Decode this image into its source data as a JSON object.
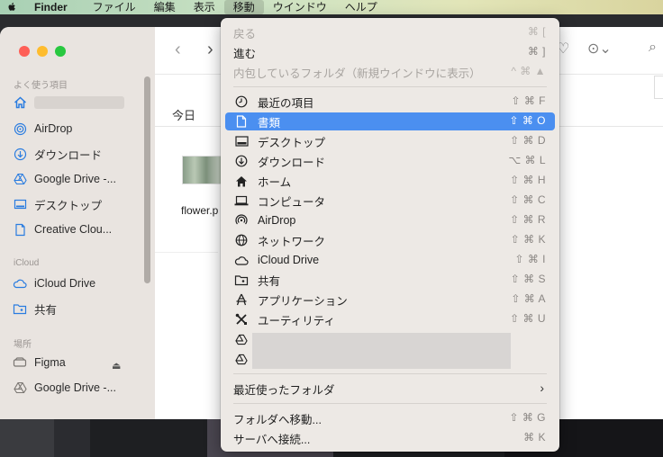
{
  "menubar": {
    "items": [
      {
        "label": "Finder",
        "bold": true,
        "active": false
      },
      {
        "label": "ファイル",
        "bold": false,
        "active": false
      },
      {
        "label": "編集",
        "bold": false,
        "active": false
      },
      {
        "label": "表示",
        "bold": false,
        "active": false
      },
      {
        "label": "移動",
        "bold": false,
        "active": true
      },
      {
        "label": "ウインドウ",
        "bold": false,
        "active": false
      },
      {
        "label": "ヘルプ",
        "bold": false,
        "active": false
      }
    ]
  },
  "sidebar": {
    "sections": {
      "favorites": "よく使う項目",
      "icloud": "iCloud",
      "locations": "場所"
    },
    "items": [
      {
        "label": "",
        "icon": "house-icon"
      },
      {
        "label": "AirDrop",
        "icon": "airdrop-icon"
      },
      {
        "label": "ダウンロード",
        "icon": "download-icon"
      },
      {
        "label": "Google Drive -...",
        "icon": "google-drive-icon"
      },
      {
        "label": "デスクトップ",
        "icon": "desktop-icon"
      },
      {
        "label": "Creative Clou...",
        "icon": "document-icon"
      },
      {
        "label": "iCloud Drive",
        "icon": "cloud-icon"
      },
      {
        "label": "共有",
        "icon": "shared-folder-icon"
      },
      {
        "label": "Figma",
        "icon": "drive-icon"
      },
      {
        "label": "Google Drive -...",
        "icon": "google-drive-icon"
      }
    ]
  },
  "content": {
    "group_header": "今日",
    "file_name": "flower.p"
  },
  "menu": {
    "items": [
      {
        "label": "戻る",
        "shortcut": "⌘ [",
        "disabled": true
      },
      {
        "label": "進む",
        "shortcut": "⌘ ]",
        "disabled": false
      },
      {
        "label": "内包しているフォルダ（新規ウインドウに表示）",
        "shortcut": "^ ⌘ ▲",
        "disabled": true
      },
      {
        "label": "最近の項目",
        "shortcut": "⇧ ⌘ F",
        "icon": "clock-icon"
      },
      {
        "label": "書類",
        "shortcut": "⇧ ⌘ O",
        "icon": "document-icon",
        "highlighted": true
      },
      {
        "label": "デスクトップ",
        "shortcut": "⇧ ⌘ D",
        "icon": "desktop-icon"
      },
      {
        "label": "ダウンロード",
        "shortcut": "⌥ ⌘ L",
        "icon": "download-icon"
      },
      {
        "label": "ホーム",
        "shortcut": "⇧ ⌘ H",
        "icon": "house-icon"
      },
      {
        "label": "コンピュータ",
        "shortcut": "⇧ ⌘ C",
        "icon": "laptop-icon"
      },
      {
        "label": "AirDrop",
        "shortcut": "⇧ ⌘ R",
        "icon": "airdrop-icon"
      },
      {
        "label": "ネットワーク",
        "shortcut": "⇧ ⌘ K",
        "icon": "globe-icon"
      },
      {
        "label": "iCloud Drive",
        "shortcut": "⇧ ⌘ I",
        "icon": "cloud-icon"
      },
      {
        "label": "共有",
        "shortcut": "⇧ ⌘ S",
        "icon": "shared-folder-icon"
      },
      {
        "label": "アプリケーション",
        "shortcut": "⇧ ⌘ A",
        "icon": "applications-icon"
      },
      {
        "label": "ユーティリティ",
        "shortcut": "⇧ ⌘ U",
        "icon": "utilities-icon"
      }
    ],
    "recent_folders": "最近使ったフォルダ",
    "go_to_folder": {
      "label": "フォルダへ移動...",
      "shortcut": "⇧ ⌘ G"
    },
    "connect_server": {
      "label": "サーバへ接続...",
      "shortcut": "⌘ K"
    }
  },
  "colors": {
    "highlight": "#4b8ff0",
    "traffic_red": "#fe5f57",
    "traffic_yellow": "#febc2e",
    "traffic_green": "#28c840"
  }
}
